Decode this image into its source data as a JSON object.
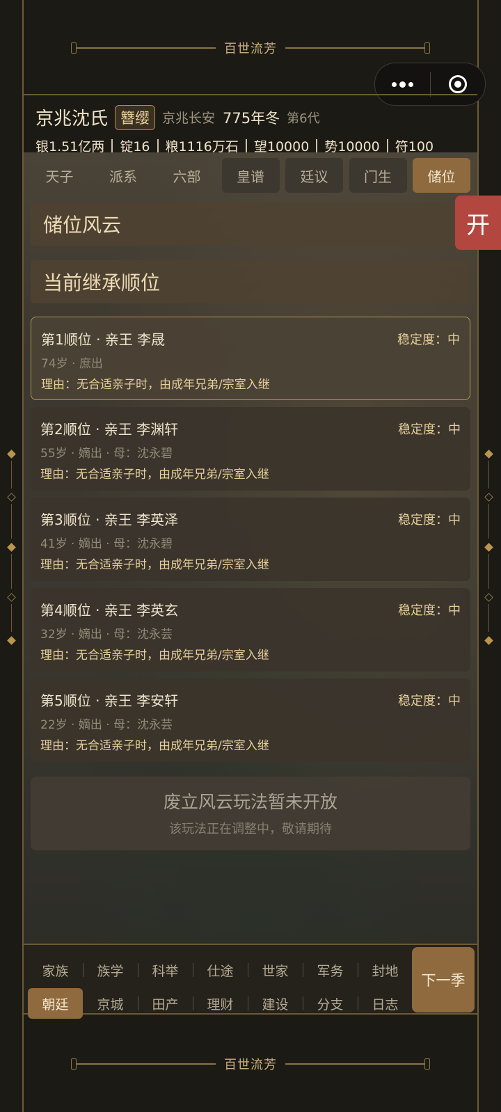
{
  "app": {
    "title": "百世流芳"
  },
  "capsule": {
    "more_icon": "more-dots-icon",
    "close_icon": "target-close-icon"
  },
  "header": {
    "family": "京兆沈氏",
    "rank": "簪缨",
    "location": "京兆长安",
    "date": "775年冬",
    "generation": "第6代",
    "resources": [
      "银1.51亿两",
      "锭16",
      "粮1116万石",
      "望10000",
      "势10000",
      "符100"
    ]
  },
  "tabs": [
    {
      "label": "天子"
    },
    {
      "label": "派系"
    },
    {
      "label": "六部"
    },
    {
      "label": "皇谱"
    },
    {
      "label": "廷议"
    },
    {
      "label": "门生"
    },
    {
      "label": "储位"
    }
  ],
  "active_tab": "储位",
  "section_title": "储位风云",
  "subsection_title": "当前继承顺位",
  "succession": [
    {
      "title": "第1顺位 · 亲王 李晟",
      "stability": "稳定度：中",
      "meta": "74岁 · 庶出",
      "reason": "理由：无合适亲子时，由成年兄弟/宗室入继"
    },
    {
      "title": "第2顺位 · 亲王 李渊轩",
      "stability": "稳定度：中",
      "meta": "55岁 · 嫡出 · 母：沈永碧",
      "reason": "理由：无合适亲子时，由成年兄弟/宗室入继"
    },
    {
      "title": "第3顺位 · 亲王 李英泽",
      "stability": "稳定度：中",
      "meta": "41岁 · 嫡出 · 母：沈永碧",
      "reason": "理由：无合适亲子时，由成年兄弟/宗室入继"
    },
    {
      "title": "第4顺位 · 亲王 李英玄",
      "stability": "稳定度：中",
      "meta": "32岁 · 嫡出 · 母：沈永芸",
      "reason": "理由：无合适亲子时，由成年兄弟/宗室入继"
    },
    {
      "title": "第5顺位 · 亲王 李安轩",
      "stability": "稳定度：中",
      "meta": "22岁 · 嫡出 · 母：沈永芸",
      "reason": "理由：无合适亲子时，由成年兄弟/宗室入继"
    }
  ],
  "notice": {
    "title": "废立风云玩法暂未开放",
    "subtitle": "该玩法正在调整中，敬请期待"
  },
  "open_button": "开",
  "bottom_nav": {
    "row1": [
      "家族",
      "族学",
      "科举",
      "仕途",
      "世家",
      "军务",
      "封地"
    ],
    "row2": [
      "朝廷",
      "京城",
      "田产",
      "理财",
      "建设",
      "分支",
      "日志"
    ],
    "active": "朝廷",
    "next_label": "下一季"
  },
  "colors": {
    "accent": "#8e6a3e",
    "background": "#1c1a15",
    "gold_text": "#e6cf9a",
    "open_button": "#b3463f"
  }
}
